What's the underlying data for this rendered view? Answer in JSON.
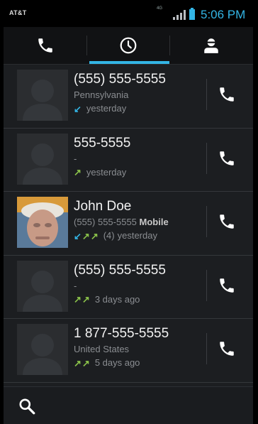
{
  "status_bar": {
    "carrier": "AT&T",
    "network_type": "4G",
    "time": "5:06 PM",
    "accent_color": "#33b5e5"
  },
  "tabs": [
    {
      "name": "phone",
      "icon": "phone-icon",
      "selected": false
    },
    {
      "name": "call-log",
      "icon": "clock-icon",
      "selected": true
    },
    {
      "name": "contacts",
      "icon": "person-icon",
      "selected": false
    }
  ],
  "calls": [
    {
      "name": "(555) 555-5555",
      "detail": "Pennsylvania",
      "phone_type": "",
      "arrows": [
        "incoming"
      ],
      "count": "",
      "when": "yesterday",
      "avatar": "default"
    },
    {
      "name": "555-5555",
      "detail": "-",
      "phone_type": "",
      "arrows": [
        "outgoing"
      ],
      "count": "",
      "when": "yesterday",
      "avatar": "default"
    },
    {
      "name": "John Doe",
      "detail": "(555) 555-5555",
      "phone_type": "Mobile",
      "arrows": [
        "incoming",
        "outgoing",
        "outgoing"
      ],
      "count": "(4)",
      "when": "yesterday",
      "avatar": "photo"
    },
    {
      "name": "(555) 555-5555",
      "detail": "-",
      "phone_type": "",
      "arrows": [
        "outgoing",
        "outgoing"
      ],
      "count": "",
      "when": "3 days ago",
      "avatar": "default"
    },
    {
      "name": "1 877-555-5555",
      "detail": "United States",
      "phone_type": "",
      "arrows": [
        "outgoing",
        "outgoing"
      ],
      "count": "",
      "when": "5 days ago",
      "avatar": "default"
    }
  ],
  "bottom_bar": {
    "icon": "search-icon"
  },
  "colors": {
    "incoming": "#33b5e5",
    "outgoing": "#8bc34a"
  }
}
